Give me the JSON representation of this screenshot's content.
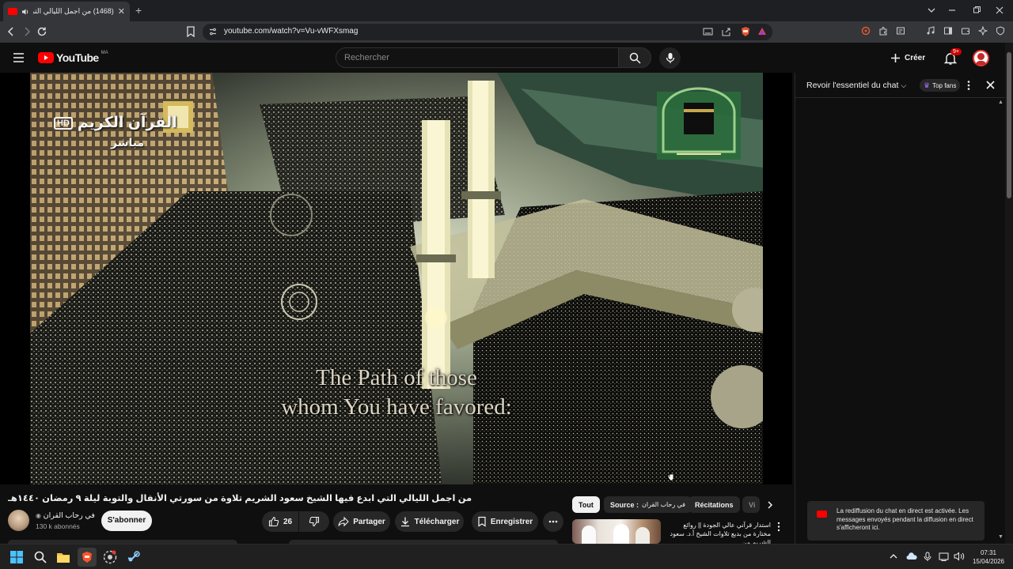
{
  "browser": {
    "tab_title": "(1468) من اجمل الليالي التي ا",
    "url": "youtube.com/watch?v=Vu-vWFXsmag",
    "new_tab_icon": "plus-icon"
  },
  "youtube": {
    "logo_text": "YouTube",
    "region": "MA",
    "search_placeholder": "Rechercher",
    "create_label": "Créer",
    "notif_count": "9+"
  },
  "video": {
    "caption_line1": "The Path of those",
    "caption_line2": "whom You have favored:",
    "overlay_channel": "القرآن الكريم",
    "overlay_live": "مباشر",
    "overlay_hd": "HD"
  },
  "chat": {
    "title": "Revoir l'essentiel du chat",
    "top_fans": "Top fans",
    "notice": "La rediffusion du chat en direct est activée. Les messages envoyés pendant la diffusion en direct s'afficheront ici."
  },
  "watch": {
    "title": "من اجمل الليالي التي ابدع فيها الشيخ سعود الشريم تلاوة من سورتي الأنفال والتوبة ليلة ٩ رمضان ١٤٤٠هـ",
    "channel_name": "في رحاب القران",
    "subscribers": "130 k abonnés",
    "subscribe_label": "S'abonner",
    "likes": "26",
    "share_label": "Partager",
    "download_label": "Télécharger",
    "save_label": "Enregistrer"
  },
  "chips": {
    "all": "Tout",
    "source_prefix": "Source :",
    "source_value": "في رحاب القران",
    "recitations": "Récitations",
    "partial": "Vi"
  },
  "recommendation": {
    "title": "استدار قرآني عالي الجودة || روائع مختارة من بديع تلاوات الشيخ أ.د. سعود الشريم من"
  },
  "taskbar": {
    "time": "07:31",
    "date": "15/04/2026"
  }
}
